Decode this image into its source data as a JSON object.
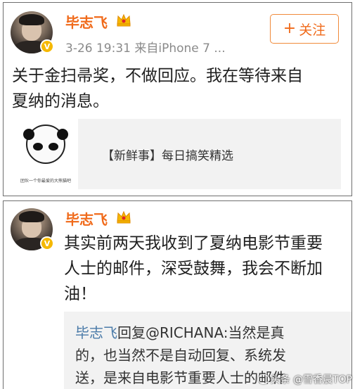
{
  "post1": {
    "username": "毕志飞",
    "meta": "3-26 19:31  来自iPhone 7 ...",
    "follow_label": "关注",
    "text_line1": "关于金扫帚奖，不做回应。我在等待来自",
    "text_line2": "夏纳的消息。",
    "share_card": {
      "title": "【新鲜事】每日搞笑精选",
      "thumb_caption": "团伙一个你最爱的大熊猫吧"
    }
  },
  "post2": {
    "username": "毕志飞",
    "text_line1": "其实前两天我收到了夏纳电影节重要",
    "text_line2": "人士的邮件，深受鼓舞，我会不断加",
    "text_line3": "油！",
    "reply": {
      "user": "毕志飞",
      "line1_rest": "回复@RICHANA:当然是真",
      "line2": "的，也当然不是自动回复、系统发",
      "line3": "送，是来自电影节重要人士的邮件"
    }
  },
  "watermark": "头条 @雪香晨TOP",
  "colors": {
    "username": "#f06a1a",
    "follow_border": "#f08a3a",
    "reply_user": "#4a7aa8",
    "vip_badge": "#f5b800"
  }
}
